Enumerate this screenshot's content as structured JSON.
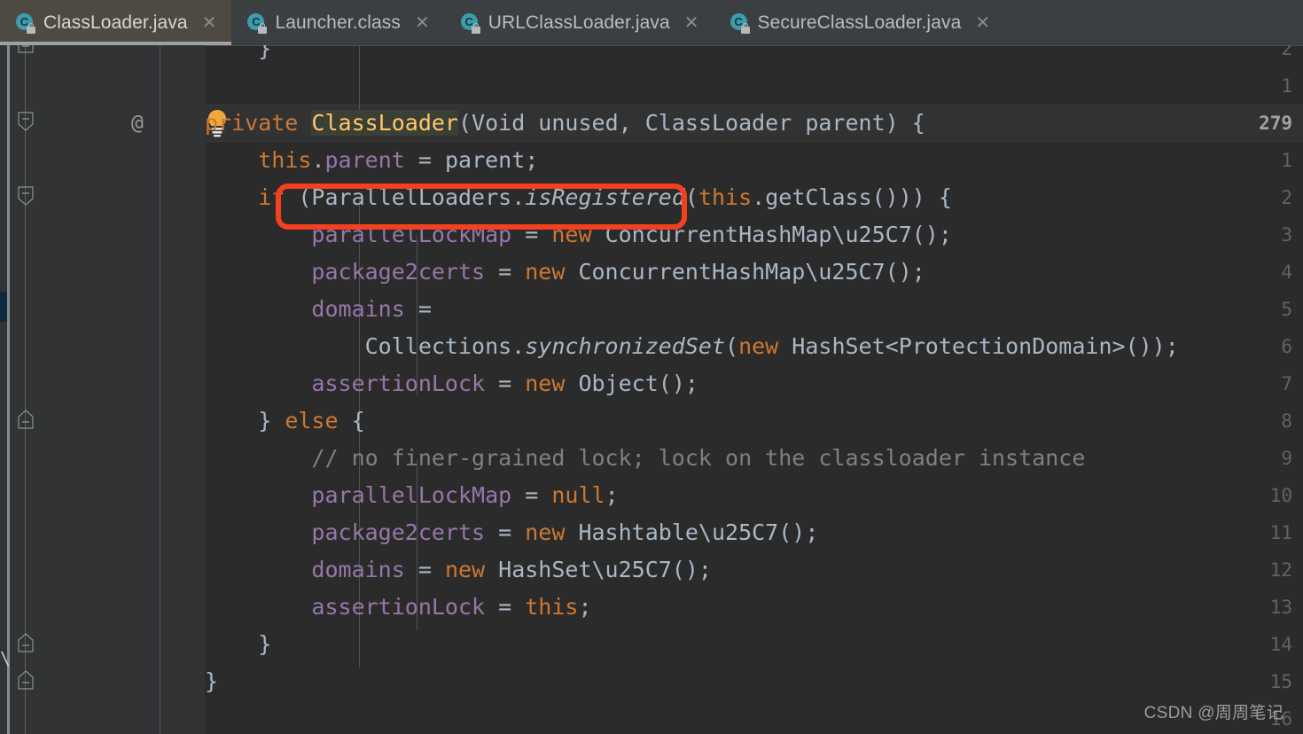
{
  "tabs": [
    {
      "label": "ClassLoader.java",
      "icon": "java-class-locked-icon",
      "active": true,
      "close": "✕",
      "badge": "C"
    },
    {
      "label": "Launcher.class",
      "icon": "java-class-locked-icon",
      "active": false,
      "close": "✕",
      "badge": "C"
    },
    {
      "label": "URLClassLoader.java",
      "icon": "java-class-locked-icon",
      "active": false,
      "close": "✕",
      "badge": "C"
    },
    {
      "label": "SecureClassLoader.java",
      "icon": "java-class-locked-icon",
      "active": false,
      "close": "✕",
      "badge": "C"
    }
  ],
  "gutter": {
    "annotation_marker": "@",
    "line_numbers": [
      "2",
      "1",
      "279",
      "1",
      "2",
      "3",
      "4",
      "5",
      "6",
      "7",
      "8",
      "9",
      "10",
      "11",
      "12",
      "13",
      "14",
      "15",
      "16"
    ],
    "current_line_number": "279",
    "current_line_index": 2,
    "intention_icon": "lightbulb-icon"
  },
  "code": {
    "lines": [
      {
        "indent": "    ",
        "text": "}"
      },
      {
        "indent": "",
        "text": ""
      },
      {
        "indent": "",
        "text": "private ClassLoader(Void unused, ClassLoader parent) {"
      },
      {
        "indent": "",
        "text": "    this.parent = parent;"
      },
      {
        "indent": "",
        "text": "    if (ParallelLoaders.isRegistered(this.getClass())) {"
      },
      {
        "indent": "",
        "text": "        parallelLockMap = new ConcurrentHashMap<>();"
      },
      {
        "indent": "",
        "text": "        package2certs = new ConcurrentHashMap<>();"
      },
      {
        "indent": "",
        "text": "        domains ="
      },
      {
        "indent": "",
        "text": "            Collections.synchronizedSet(new HashSet<ProtectionDomain>());"
      },
      {
        "indent": "",
        "text": "        assertionLock = new Object();"
      },
      {
        "indent": "",
        "text": "    } else {"
      },
      {
        "indent": "",
        "text": "        // no finer-grained lock; lock on the classloader instance"
      },
      {
        "indent": "",
        "text": "        parallelLockMap = null;"
      },
      {
        "indent": "",
        "text": "        package2certs = new Hashtable<>();"
      },
      {
        "indent": "",
        "text": "        domains = new HashSet<>();"
      },
      {
        "indent": "",
        "text": "        assertionLock = this;"
      },
      {
        "indent": "",
        "text": "    }"
      },
      {
        "indent": "",
        "text": "}"
      },
      {
        "indent": "",
        "text": ""
      }
    ],
    "highlighted_identifier": "ClassLoader",
    "annotated_line": "this.parent = parent;",
    "left_edge_glyph": "\\"
  },
  "annotation": {
    "shape": "rounded-rectangle",
    "color": "#f4401f",
    "target_text": "this.parent = parent;"
  },
  "watermark": {
    "text": "CSDN @周周笔记"
  },
  "colors": {
    "editor_bg": "#2b2b2b",
    "gutter_bg": "#313335",
    "tabbar_bg": "#3c3f41",
    "active_tab_bg": "#4e4a41",
    "active_tab_underline": "#9da2a8",
    "keyword": "#cc7832",
    "field": "#9876aa",
    "method": "#ffc66d",
    "comment": "#808080",
    "default_text": "#a9b7c6",
    "annotation": "#f4401f",
    "identifier_highlight": "#3b4034",
    "left_marker": "#0d293e"
  }
}
